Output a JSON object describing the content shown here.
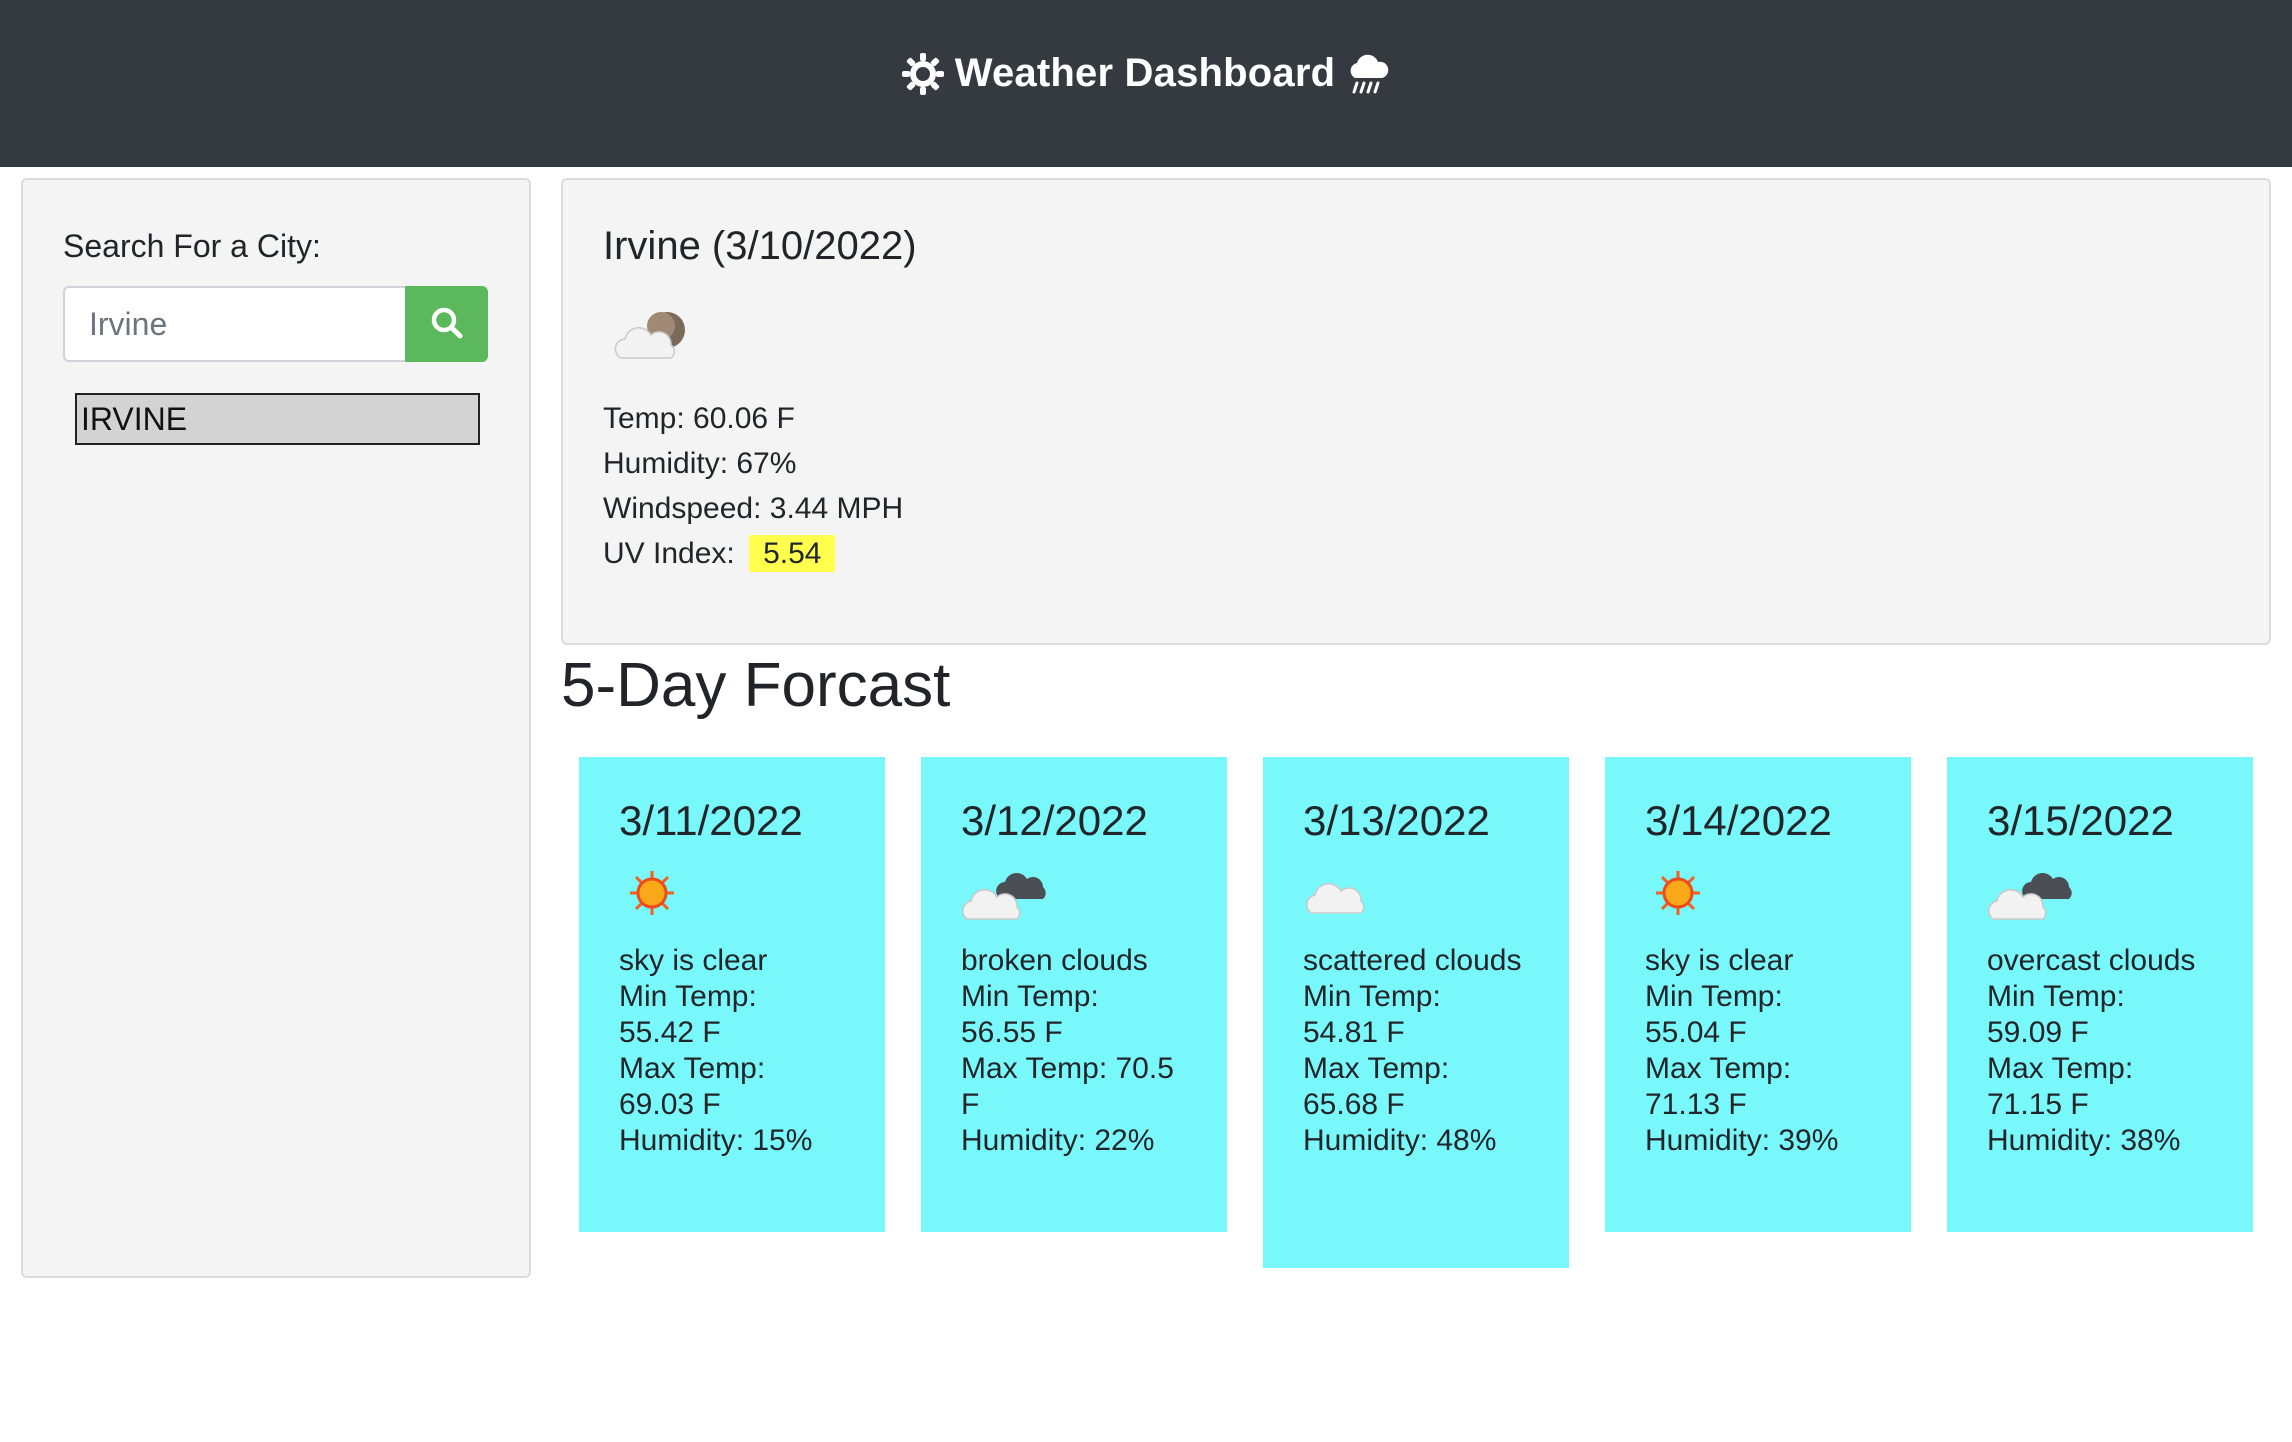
{
  "header": {
    "title": "Weather Dashboard"
  },
  "search": {
    "label": "Search For a City:",
    "value": "Irvine",
    "history": [
      "IRVINE"
    ]
  },
  "current": {
    "title": "Irvine (3/10/2022)",
    "icon": "partly-cloudy-night-icon",
    "temp": "Temp: 60.06 F",
    "humidity": "Humidity: 67%",
    "windspeed": "Windspeed: 3.44 MPH",
    "uv_label": "UV Index:",
    "uv_value": "5.54",
    "uv_color": "#ffff4d"
  },
  "forecast": {
    "heading": "5-Day Forcast",
    "card_color": "#78f8fb",
    "days": [
      {
        "date": "3/11/2022",
        "icon": "sun-icon",
        "desc": "sky is clear",
        "min_label": "Min Temp:",
        "min": "55.42 F",
        "max_label": "Max Temp:",
        "max": "69.03 F",
        "humidity": "Humidity: 15%"
      },
      {
        "date": "3/12/2022",
        "icon": "broken-clouds-icon",
        "desc": "broken clouds",
        "min_label": "Min Temp:",
        "min": "56.55 F",
        "max_label": "Max Temp: 70.5",
        "max": "F",
        "humidity": "Humidity: 22%"
      },
      {
        "date": "3/13/2022",
        "icon": "cloud-icon",
        "desc": "scattered clouds",
        "min_label": "Min Temp:",
        "min": "54.81 F",
        "max_label": "Max Temp:",
        "max": "65.68 F",
        "humidity": "Humidity: 48%"
      },
      {
        "date": "3/14/2022",
        "icon": "sun-icon",
        "desc": "sky is clear",
        "min_label": "Min Temp:",
        "min": "55.04 F",
        "max_label": "Max Temp:",
        "max": "71.13 F",
        "humidity": "Humidity: 39%"
      },
      {
        "date": "3/15/2022",
        "icon": "overcast-clouds-icon",
        "desc": "overcast clouds",
        "min_label": "Min Temp:",
        "min": "59.09 F",
        "max_label": "Max Temp:",
        "max": "71.15 F",
        "humidity": "Humidity: 38%"
      }
    ]
  }
}
